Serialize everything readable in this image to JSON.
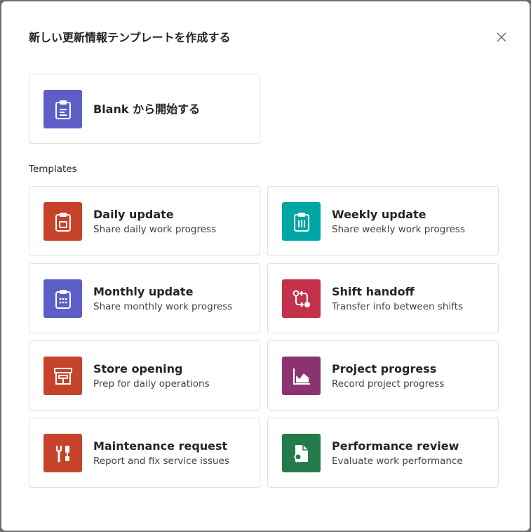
{
  "dialog": {
    "title": "新しい更新情報テンプレートを作成する",
    "close_icon": "close-icon"
  },
  "blank": {
    "label": "Blank から開始する",
    "icon": "clipboard-icon",
    "color": "#5b5fc7"
  },
  "templates_label": "Templates",
  "templates": [
    {
      "title": "Daily update",
      "desc": "Share daily work progress",
      "icon": "clipboard-day-icon",
      "color": "#c4432a"
    },
    {
      "title": "Weekly update",
      "desc": "Share weekly work progress",
      "icon": "clipboard-week-icon",
      "color": "#00a6a6"
    },
    {
      "title": "Monthly update",
      "desc": "Share monthly work progress",
      "icon": "clipboard-month-icon",
      "color": "#5b5fc7"
    },
    {
      "title": "Shift handoff",
      "desc": "Transfer info between shifts",
      "icon": "handoff-arrows-icon",
      "color": "#c4314b"
    },
    {
      "title": "Store opening",
      "desc": "Prep for daily operations",
      "icon": "store-icon",
      "color": "#c4432a"
    },
    {
      "title": "Project progress",
      "desc": "Record project progress",
      "icon": "area-chart-icon",
      "color": "#8a3370"
    },
    {
      "title": "Maintenance request",
      "desc": "Report and fix service issues",
      "icon": "wrench-screwdriver-icon",
      "color": "#c4432a"
    },
    {
      "title": "Performance review",
      "desc": "Evaluate work performance",
      "icon": "document-ribbon-icon",
      "color": "#237b4b"
    }
  ]
}
